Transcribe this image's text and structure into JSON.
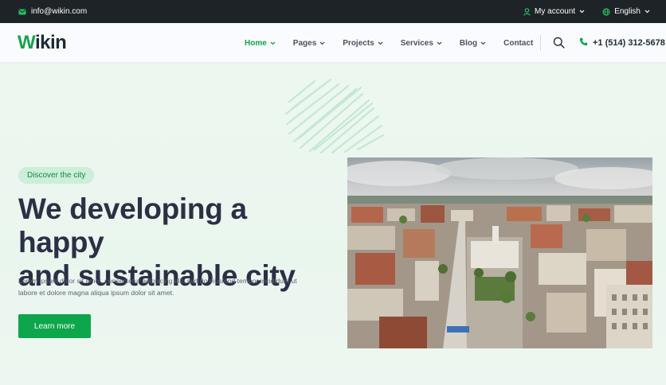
{
  "topbar": {
    "email": "info@wikin.com",
    "account_label": "My account",
    "language_label": "English"
  },
  "header": {
    "logo_first": "W",
    "logo_rest": "ikin",
    "nav": [
      {
        "label": "Home",
        "active": true,
        "has_dropdown": true
      },
      {
        "label": "Pages",
        "active": false,
        "has_dropdown": true
      },
      {
        "label": "Projects",
        "active": false,
        "has_dropdown": true
      },
      {
        "label": "Services",
        "active": false,
        "has_dropdown": true
      },
      {
        "label": "Blog",
        "active": false,
        "has_dropdown": true
      },
      {
        "label": "Contact",
        "active": false,
        "has_dropdown": false
      }
    ],
    "phone": "+1 (514) 312-5678"
  },
  "hero": {
    "badge": "Discover the city",
    "headline_line1": "We developing a happy",
    "headline_line2": "and sustainable city",
    "description_line1": "Lorem ipsum dolor sit amet, consectetur adipiscing elit, sed do eiusmod tempor incididunt ut",
    "description_line2": "labore et dolore magna aliqua ipsum dolor sit amet.",
    "cta_label": "Learn more"
  },
  "colors": {
    "brand_green": "#0ea64a",
    "topbar_bg": "#1d2327",
    "heading": "#2c2f45"
  },
  "icons": {
    "email": "envelope-icon",
    "account": "user-icon",
    "language": "globe-icon",
    "search": "search-icon",
    "phone": "phone-icon",
    "dropdown": "chevron-down-icon"
  }
}
